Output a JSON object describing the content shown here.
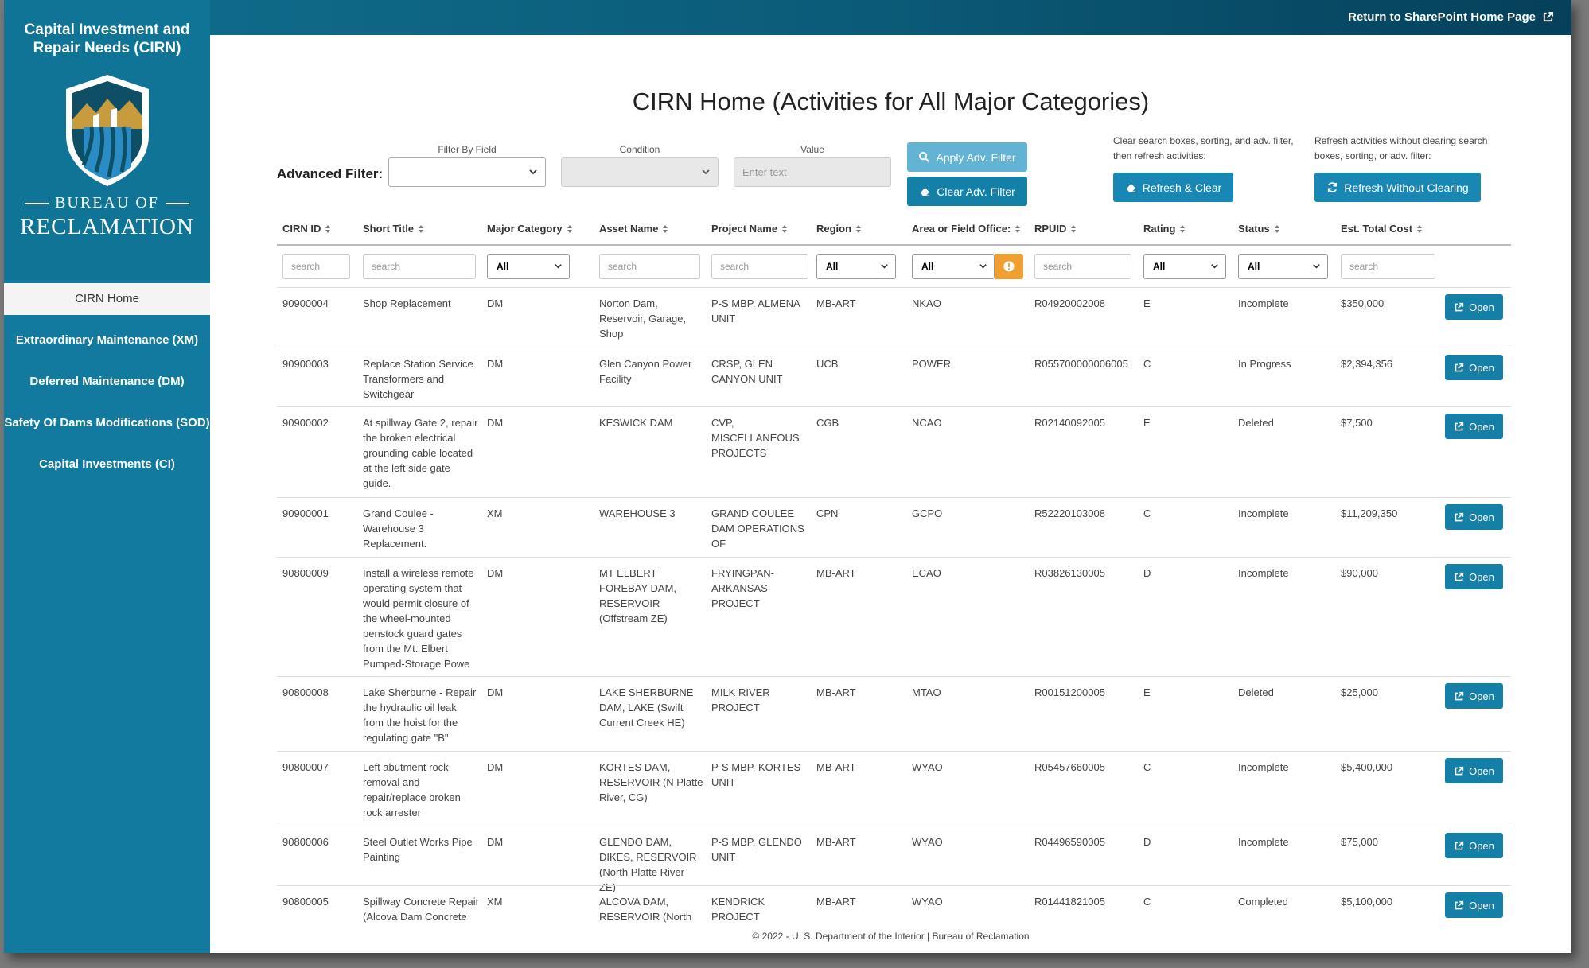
{
  "app": {
    "title": "Capital Investment and Repair Needs (CIRN)",
    "agency_top": "BUREAU OF",
    "agency_name": "RECLAMATION"
  },
  "topbar": {
    "return_link": "Return to SharePoint Home Page"
  },
  "nav": [
    {
      "label": "CIRN Home",
      "active": true
    },
    {
      "label": "Extraordinary Maintenance (XM)"
    },
    {
      "label": "Deferred Maintenance (DM)"
    },
    {
      "label": "Safety Of Dams Modifications (SOD)"
    },
    {
      "label": "Capital Investments (CI)"
    }
  ],
  "page": {
    "title": "CIRN Home (Activities for All Major Categories)"
  },
  "advanced_filter": {
    "label": "Advanced Filter:",
    "field_label": "Filter By Field",
    "condition_label": "Condition",
    "value_label": "Value",
    "value_placeholder": "Enter text",
    "apply_label": "Apply Adv. Filter",
    "clear_label": "Clear Adv. Filter"
  },
  "refresh": {
    "clear_help": "Clear search boxes, sorting, and adv. filter, then refresh activities:",
    "clear_label": "Refresh & Clear",
    "keep_help": "Refresh activities without clearing search boxes, sorting, or adv. filter:",
    "keep_label": "Refresh Without Clearing"
  },
  "table": {
    "columns": [
      "CIRN ID",
      "Short Title",
      "Major Category",
      "Asset Name",
      "Project Name",
      "Region",
      "Area or Field Office:",
      "RPUID",
      "Rating",
      "Status",
      "Est. Total Cost"
    ],
    "search_placeholder": "search",
    "dropdown_value": "All",
    "open_label": "Open",
    "rows": [
      {
        "id": "90900004",
        "title": "Shop Replacement",
        "category": "DM",
        "asset": "Norton Dam, Reservoir, Garage, Shop",
        "project": "P-S MBP, ALMENA UNIT",
        "region": "MB-ART",
        "office": "NKAO",
        "rpuid": "R04920002008",
        "rating": "E",
        "status": "Incomplete",
        "cost": "$350,000"
      },
      {
        "id": "90900003",
        "title": "Replace Station Service Transformers and Switchgear",
        "category": "DM",
        "asset": "Glen Canyon Power Facility",
        "project": "CRSP, GLEN CANYON UNIT",
        "region": "UCB",
        "office": "POWER",
        "rpuid": "R055700000006005",
        "rating": "C",
        "status": "In Progress",
        "cost": "$2,394,356"
      },
      {
        "id": "90900002",
        "title": "At spillway Gate 2, repair the broken electrical grounding cable located at the left side gate guide.",
        "category": "DM",
        "asset": "KESWICK DAM",
        "project": "CVP, MISCELLANEOUS PROJECTS",
        "region": "CGB",
        "office": "NCAO",
        "rpuid": "R02140092005",
        "rating": "E",
        "status": "Deleted",
        "cost": "$7,500"
      },
      {
        "id": "90900001",
        "title": "Grand Coulee - Warehouse 3 Replacement.",
        "category": "XM",
        "asset": "WAREHOUSE 3",
        "project": "GRAND COULEE DAM OPERATIONS OF",
        "region": "CPN",
        "office": "GCPO",
        "rpuid": "R52220103008",
        "rating": "C",
        "status": "Incomplete",
        "cost": "$11,209,350"
      },
      {
        "id": "90800009",
        "title": "Install a wireless remote operating system that would permit closure of the wheel-mounted penstock guard gates from the Mt. Elbert Pumped-Storage Powe",
        "category": "DM",
        "asset": "MT ELBERT FOREBAY DAM, RESERVOIR (Offstream ZE)",
        "project": "FRYINGPAN-ARKANSAS PROJECT",
        "region": "MB-ART",
        "office": "ECAO",
        "rpuid": "R03826130005",
        "rating": "D",
        "status": "Incomplete",
        "cost": "$90,000"
      },
      {
        "id": "90800008",
        "title": "Lake Sherburne - Repair the hydraulic oil leak from the hoist for the regulating gate \"B\"",
        "category": "DM",
        "asset": "LAKE SHERBURNE DAM, LAKE (Swift Current Creek HE)",
        "project": "MILK RIVER PROJECT",
        "region": "MB-ART",
        "office": "MTAO",
        "rpuid": "R00151200005",
        "rating": "E",
        "status": "Deleted",
        "cost": "$25,000"
      },
      {
        "id": "90800007",
        "title": "Left abutment rock removal and repair/replace broken rock arrester",
        "category": "DM",
        "asset": "KORTES DAM, RESERVOIR (N Platte River, CG)",
        "project": "P-S MBP, KORTES UNIT",
        "region": "MB-ART",
        "office": "WYAO",
        "rpuid": "R05457660005",
        "rating": "C",
        "status": "Incomplete",
        "cost": "$5,400,000"
      },
      {
        "id": "90800006",
        "title": "Steel Outlet Works Pipe Painting",
        "category": "DM",
        "asset": "GLENDO DAM, DIKES, RESERVOIR (North Platte River ZE)",
        "project": "P-S MBP, GLENDO UNIT",
        "region": "MB-ART",
        "office": "WYAO",
        "rpuid": "R04496590005",
        "rating": "D",
        "status": "Incomplete",
        "cost": "$75,000"
      },
      {
        "id": "90800005",
        "title": "Spillway Concrete Repair (Alcova Dam Concrete",
        "category": "XM",
        "asset": "ALCOVA DAM, RESERVOIR (North",
        "project": "KENDRICK PROJECT",
        "region": "MB-ART",
        "office": "WYAO",
        "rpuid": "R01441821005",
        "rating": "C",
        "status": "Completed",
        "cost": "$5,100,000"
      }
    ]
  },
  "footer": {
    "text": "© 2022 - U. S. Department of the Interior | Bureau of Reclamation"
  },
  "colors": {
    "sidebar": "#127a9e",
    "accent": "#1480a8",
    "accent_light": "#62b3d4",
    "warning": "#f0a030"
  }
}
